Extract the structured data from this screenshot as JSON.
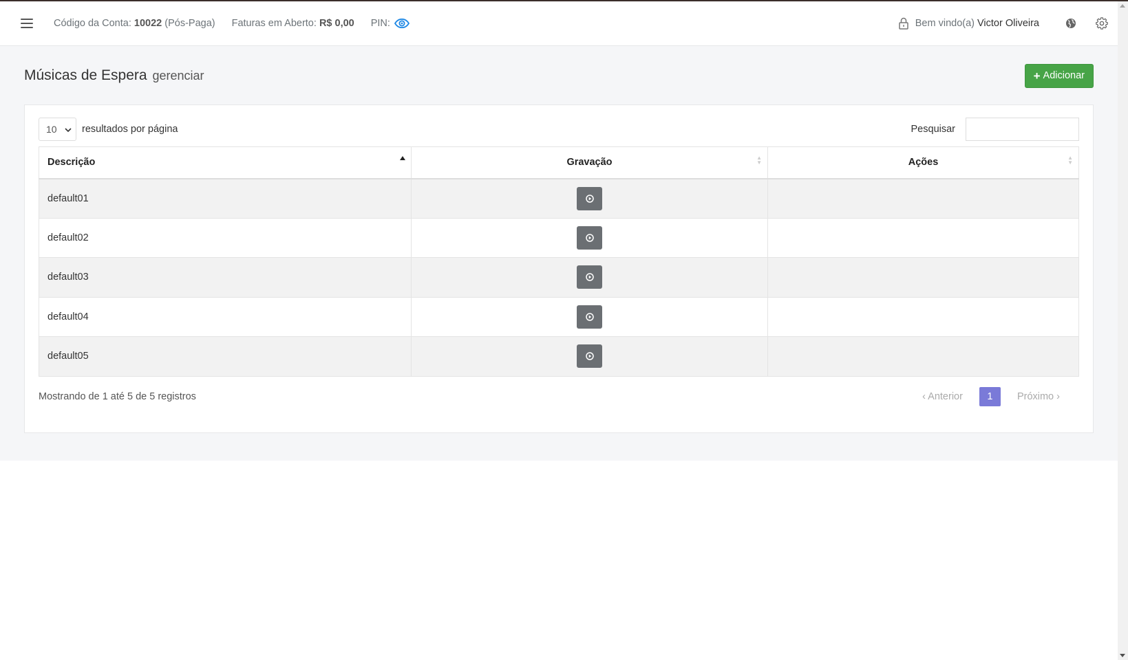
{
  "navbar": {
    "account_label": "Código da Conta:",
    "account_code": "10022",
    "account_type": "(Pós-Paga)",
    "invoices_label": "Faturas em Aberto:",
    "invoices_value": "R$ 0,00",
    "pin_label": "PIN:",
    "welcome_label": "Bem vindo(a)",
    "user_name": "Victor Oliveira"
  },
  "page": {
    "title": "Músicas de Espera",
    "subtitle": "gerenciar",
    "add_button": "Adicionar"
  },
  "table_controls": {
    "page_length": "10",
    "page_length_label": "resultados por página",
    "search_label": "Pesquisar",
    "search_value": ""
  },
  "table": {
    "columns": [
      "Descrição",
      "Gravação",
      "Ações"
    ],
    "rows": [
      {
        "descricao": "default01"
      },
      {
        "descricao": "default02"
      },
      {
        "descricao": "default03"
      },
      {
        "descricao": "default04"
      },
      {
        "descricao": "default05"
      }
    ]
  },
  "footer": {
    "info": "Mostrando de 1 até 5 de 5 registros",
    "prev": "Anterior",
    "current_page": "1",
    "next": "Próximo"
  },
  "colors": {
    "accent_green": "#47a447",
    "pin_eye": "#1e88e5",
    "pager_active": "#7a7ad8",
    "play_button": "#6b6f73"
  },
  "icons": [
    "hamburger-icon",
    "eye-icon",
    "lock-icon",
    "globe-icon",
    "gear-icon",
    "plus-icon",
    "play-icon",
    "chevron-left-icon",
    "chevron-right-icon"
  ]
}
